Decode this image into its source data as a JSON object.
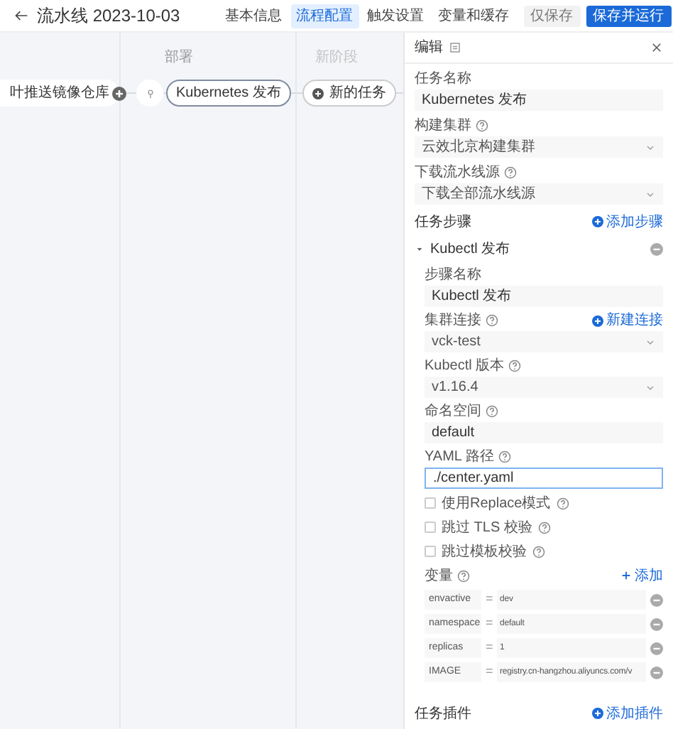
{
  "header": {
    "title": "流水线 2023-10-03",
    "tabs": [
      {
        "label": "基本信息",
        "selected": false
      },
      {
        "label": "流程配置",
        "selected": true
      },
      {
        "label": "触发设置",
        "selected": false
      },
      {
        "label": "变量和缓存",
        "selected": false
      }
    ],
    "buttons": [
      {
        "label": "仅保存",
        "kind": "secondary"
      },
      {
        "label": "保存并运行",
        "kind": "primary"
      }
    ]
  },
  "canvas": {
    "stages": [
      {
        "label": "部署"
      },
      {
        "label": "新阶段"
      }
    ],
    "nodes": [
      {
        "kind": "task",
        "label": "叶推送镜像仓库",
        "selected": false
      },
      {
        "kind": "add"
      },
      {
        "kind": "pin"
      },
      {
        "kind": "task",
        "label": "Kubernetes 发布",
        "selected": true
      },
      {
        "kind": "new",
        "label": "新的任务"
      }
    ]
  },
  "panel": {
    "title": "编辑",
    "fields": [
      {
        "kind": "input",
        "label": "任务名称",
        "help": false,
        "value": "Kubernetes 发布"
      },
      {
        "kind": "select",
        "label": "构建集群",
        "help": true,
        "value": "云效北京构建集群"
      },
      {
        "kind": "select",
        "label": "下载流水线源",
        "help": true,
        "value": "下载全部流水线源"
      }
    ],
    "steps_label": "任务步骤",
    "add_step": "添加步骤",
    "steps": [
      {
        "title": "Kubectl 发布",
        "expanded": true,
        "fields": [
          {
            "kind": "input",
            "label": "步骤名称",
            "help": false,
            "value": "Kubectl 发布"
          },
          {
            "kind": "select",
            "label": "集群连接",
            "help": true,
            "value": "vck-test",
            "link": "新建连接"
          },
          {
            "kind": "select",
            "label": "Kubectl 版本",
            "help": true,
            "value": "v1.16.4"
          },
          {
            "kind": "input",
            "label": "命名空间",
            "help": true,
            "value": "default"
          },
          {
            "kind": "input",
            "label": "YAML 路径",
            "help": true,
            "value": "./center.yaml",
            "focused": true
          }
        ],
        "checkboxes": [
          {
            "label": "使用Replace模式",
            "help": true,
            "checked": false
          },
          {
            "label": "跳过 TLS 校验",
            "help": true,
            "checked": false
          },
          {
            "label": "跳过模板校验",
            "help": true,
            "checked": false
          }
        ],
        "variables": {
          "label": "变量",
          "add": "添加",
          "rows": [
            {
              "key": "envactive",
              "separator": "=",
              "value": "dev"
            },
            {
              "key": "namespace",
              "separator": "=",
              "value": "default"
            },
            {
              "key": "replicas",
              "separator": "=",
              "value": "1"
            },
            {
              "key": "IMAGE",
              "separator": "=",
              "value": "registry.cn-hangzhou.aliyuncs.com/v"
            }
          ]
        }
      }
    ],
    "plugins_label": "任务插件",
    "add_plugin": "添加插件"
  }
}
